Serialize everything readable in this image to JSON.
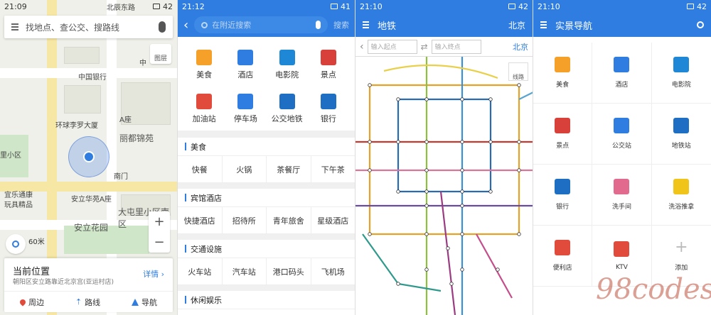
{
  "panel1": {
    "status_time": "21:09",
    "status_battery": "42",
    "search_placeholder": "找地点、查公交、搜路线",
    "layer_label": "图层",
    "labels": [
      "中国银行",
      "A座",
      "丽都锦苑",
      "南门",
      "宜乐通康",
      "玩具精品",
      "安立华苑A座",
      "大屯里小区南区",
      "安立花园",
      "环球李罗大厦",
      "北辰东路",
      "中",
      "里小区"
    ],
    "scale": "60米",
    "card_title": "当前位置",
    "card_address": "朝阳区安立路靠近北京宫(亚运村店)",
    "card_detail": "详情",
    "actions": [
      "周边",
      "路线",
      "导航"
    ]
  },
  "panel2": {
    "status_time": "21:12",
    "status_battery": "41",
    "search_placeholder": "在附近搜索",
    "search_button": "搜索",
    "categories": [
      {
        "label": "美食",
        "color": "#f4a029"
      },
      {
        "label": "酒店",
        "color": "#2f7de1"
      },
      {
        "label": "电影院",
        "color": "#1e88d6"
      },
      {
        "label": "景点",
        "color": "#d8403a"
      },
      {
        "label": "加油站",
        "color": "#e04b3c"
      },
      {
        "label": "停车场",
        "color": "#2f7de1"
      },
      {
        "label": "公交地铁",
        "color": "#1e6fc4"
      },
      {
        "label": "银行",
        "color": "#1e6fc4"
      }
    ],
    "sections": [
      {
        "title": "美食",
        "items": [
          "快餐",
          "火锅",
          "茶餐厅",
          "下午茶"
        ]
      },
      {
        "title": "宾馆酒店",
        "items": [
          "快捷酒店",
          "招待所",
          "青年旅舍",
          "星级酒店"
        ]
      },
      {
        "title": "交通设施",
        "items": [
          "火车站",
          "汽车站",
          "港口码头",
          "飞机场"
        ]
      },
      {
        "title": "休闲娱乐",
        "items": []
      }
    ]
  },
  "panel3": {
    "status_time": "21:10",
    "status_battery": "42",
    "title": "地铁",
    "city": "北京",
    "start_placeholder": "输入起点",
    "end_placeholder": "输入终点",
    "city_link": "北京",
    "lineinfo": "线路"
  },
  "panel4": {
    "status_time": "21:10",
    "status_battery": "42",
    "title": "实景导航",
    "items": [
      {
        "label": "美食",
        "color": "#f4a029"
      },
      {
        "label": "酒店",
        "color": "#2f7de1"
      },
      {
        "label": "电影院",
        "color": "#1e88d6"
      },
      {
        "label": "景点",
        "color": "#d8403a"
      },
      {
        "label": "公交站",
        "color": "#2f7de1"
      },
      {
        "label": "地铁站",
        "color": "#1e6fc4"
      },
      {
        "label": "银行",
        "color": "#1e6fc4"
      },
      {
        "label": "洗手间",
        "color": "#e26a8f"
      },
      {
        "label": "洗浴推拿",
        "color": "#f0c419"
      },
      {
        "label": "便利店",
        "color": "#e04b3c"
      },
      {
        "label": "KTV",
        "color": "#e04b3c"
      },
      {
        "label": "添加",
        "color": "#bbbbbb"
      }
    ],
    "watermark": "98codes"
  }
}
